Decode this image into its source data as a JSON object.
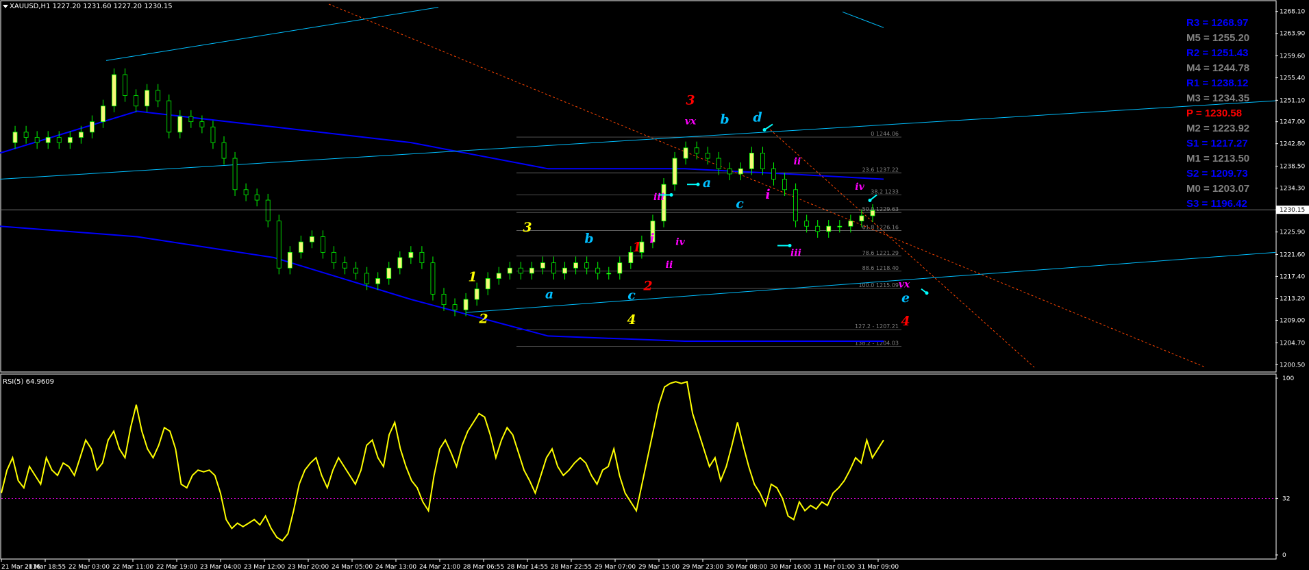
{
  "window": {
    "symbol_line": "XAUUSD,H1  1227.20 1231.60 1227.20 1230.15",
    "rsi_label": "RSI(5) 64.9609"
  },
  "colors": {
    "background": "#000000",
    "axis": "#ffffff",
    "bull_candle": "#f7f77a",
    "bear_candle": "#000000",
    "wick": "#00ff00",
    "rsi_line": "#ffff00",
    "ma_line": "#0000ff",
    "channel": "#00bfff",
    "dotted_channel": "#ff4500",
    "fib": "#808080"
  },
  "pivots": [
    {
      "label": "R3 = 1268.97",
      "color": "#0000ff",
      "price": 1268.97
    },
    {
      "label": "M5 = 1255.20",
      "color": "#808080",
      "price": 1255.2
    },
    {
      "label": "R2 = 1251.43",
      "color": "#0000ff",
      "price": 1251.43
    },
    {
      "label": "M4 = 1244.78",
      "color": "#808080",
      "price": 1244.78
    },
    {
      "label": "R1 = 1238.12",
      "color": "#0000ff",
      "price": 1238.12
    },
    {
      "label": "M3 = 1234.35",
      "color": "#808080",
      "price": 1234.35
    },
    {
      "label": "P  = 1230.58",
      "color": "#ff0000",
      "price": 1230.58
    },
    {
      "label": "M2 = 1223.92",
      "color": "#808080",
      "price": 1223.92
    },
    {
      "label": "S1 = 1217.27",
      "color": "#0000ff",
      "price": 1217.27
    },
    {
      "label": "M1 = 1213.50",
      "color": "#808080",
      "price": 1213.5
    },
    {
      "label": "S2 = 1209.73",
      "color": "#0000ff",
      "price": 1209.73
    },
    {
      "label": "M0 = 1203.07",
      "color": "#808080",
      "price": 1203.07
    },
    {
      "label": "S3 = 1196.42",
      "color": "#0000ff",
      "price": 1196.42
    }
  ],
  "chart_data": [
    {
      "type": "candlestick",
      "title": "XAUUSD,H1",
      "y_ticks": [
        "1268.10",
        "1263.90",
        "1259.60",
        "1255.40",
        "1251.10",
        "1247.00",
        "1242.80",
        "1238.50",
        "1234.30",
        "1230.15",
        "1225.90",
        "1221.60",
        "1217.40",
        "1213.20",
        "1209.00",
        "1204.70",
        "1200.50"
      ],
      "ylim": [
        1199.5,
        1269.5
      ],
      "current_price": 1230.15,
      "x_tick_labels": [
        "21 Mar 2016",
        "21 Mar 18:55",
        "22 Mar 03:00",
        "22 Mar 11:00",
        "22 Mar 19:00",
        "23 Mar 04:00",
        "23 Mar 12:00",
        "23 Mar 20:00",
        "24 Mar 05:00",
        "24 Mar 13:00",
        "24 Mar 21:00",
        "28 Mar 06:55",
        "28 Mar 14:55",
        "28 Mar 22:55",
        "29 Mar 07:00",
        "29 Mar 15:00",
        "29 Mar 23:00",
        "30 Mar 08:00",
        "30 Mar 16:00",
        "31 Mar 01:00",
        "31 Mar 09:00"
      ],
      "close_path": [
        1243,
        1245,
        1244,
        1243,
        1244,
        1243,
        1244,
        1245,
        1247,
        1250,
        1256,
        1252,
        1250,
        1253,
        1251,
        1245,
        1248,
        1247,
        1246,
        1243,
        1240,
        1234,
        1233,
        1232,
        1228,
        1219,
        1222,
        1224,
        1225,
        1222,
        1220,
        1219,
        1218,
        1216,
        1217,
        1219,
        1221,
        1222,
        1220,
        1214,
        1212,
        1211,
        1213,
        1215,
        1217,
        1218,
        1219,
        1218,
        1219,
        1220,
        1218,
        1219,
        1220,
        1219,
        1218,
        1218,
        1220,
        1222,
        1224,
        1228,
        1235,
        1240,
        1242,
        1241,
        1240,
        1238,
        1237,
        1238,
        1241,
        1238,
        1236,
        1234,
        1228,
        1227,
        1226,
        1227,
        1227,
        1228,
        1229,
        1230
      ],
      "fib_levels": [
        {
          "label": "0 1244.06",
          "price": 1244.06
        },
        {
          "label": "23.6 1237.22",
          "price": 1237.22
        },
        {
          "label": "38.2 1233",
          "price": 1233.0
        },
        {
          "label": "50.0 1229.63",
          "price": 1229.63
        },
        {
          "label": "61.8 1226.16",
          "price": 1226.16
        },
        {
          "label": "78.6 1221.29",
          "price": 1221.29
        },
        {
          "label": "88.6 1218.40",
          "price": 1218.4
        },
        {
          "label": "100.0 1215.09",
          "price": 1215.09
        },
        {
          "label": "127.2 - 1207.21",
          "price": 1207.21
        },
        {
          "label": "138.2 - 1204.03",
          "price": 1204.03
        }
      ],
      "wave_labels": [
        {
          "text": "1",
          "color": "#ffff00",
          "price": 1216.5
        },
        {
          "text": "2",
          "color": "#ffff00",
          "price": 1208.5
        },
        {
          "text": "3",
          "color": "#ffff00",
          "price": 1226.0
        },
        {
          "text": "4",
          "color": "#ffff00",
          "price": 1208.3
        },
        {
          "text": "a",
          "color": "#00bfff",
          "price": 1213.2
        },
        {
          "text": "b",
          "color": "#00bfff",
          "price": 1223.8
        },
        {
          "text": "c",
          "color": "#00bfff",
          "price": 1213.0
        },
        {
          "text": "1",
          "color": "#ff0000",
          "price": 1222.2
        },
        {
          "text": "2",
          "color": "#ff0000",
          "price": 1214.8
        },
        {
          "text": "3",
          "color": "#ff0000",
          "price": 1250.3
        },
        {
          "text": "4",
          "color": "#ff0000",
          "price": 1208.0
        },
        {
          "text": "i",
          "color": "#ff00ff",
          "price": 1223.8
        },
        {
          "text": "ii",
          "color": "#ff00ff",
          "price": 1219.0
        },
        {
          "text": "iii",
          "color": "#ff00ff",
          "price": 1232.0
        },
        {
          "text": "iv",
          "color": "#ff00ff",
          "price": 1223.4
        },
        {
          "text": "vx",
          "color": "#ff00ff",
          "price": 1246.5
        },
        {
          "text": "a",
          "color": "#00bfff",
          "price": 1234.5
        },
        {
          "text": "b",
          "color": "#00bfff",
          "price": 1246.6
        },
        {
          "text": "c",
          "color": "#00bfff",
          "price": 1230.5
        },
        {
          "text": "d",
          "color": "#00bfff",
          "price": 1247.0
        },
        {
          "text": "i",
          "color": "#ff00ff",
          "price": 1232.3
        },
        {
          "text": "ii",
          "color": "#ff00ff",
          "price": 1238.8
        },
        {
          "text": "iii",
          "color": "#ff00ff",
          "price": 1221.3
        },
        {
          "text": "iv",
          "color": "#ff00ff",
          "price": 1234.0
        },
        {
          "text": "vx",
          "color": "#ff00ff",
          "price": 1215.3
        },
        {
          "text": "e",
          "color": "#00bfff",
          "price": 1212.5
        }
      ]
    },
    {
      "type": "line",
      "title": "RSI(5) 64.9609",
      "y_ticks": [
        "100",
        "32",
        "0"
      ],
      "ylim": [
        0,
        100
      ],
      "reference_level": 32,
      "values": [
        35,
        48,
        55,
        42,
        38,
        50,
        45,
        40,
        55,
        48,
        45,
        52,
        50,
        45,
        55,
        65,
        60,
        48,
        52,
        65,
        70,
        60,
        55,
        72,
        85,
        70,
        60,
        55,
        62,
        72,
        70,
        60,
        40,
        38,
        45,
        48,
        47,
        48,
        45,
        35,
        20,
        15,
        18,
        16,
        18,
        20,
        17,
        22,
        15,
        10,
        8,
        12,
        25,
        40,
        48,
        52,
        55,
        45,
        38,
        48,
        55,
        50,
        45,
        40,
        48,
        62,
        65,
        55,
        50,
        68,
        75,
        60,
        50,
        42,
        38,
        30,
        25,
        45,
        60,
        65,
        58,
        50,
        62,
        70,
        75,
        80,
        78,
        68,
        55,
        65,
        72,
        68,
        58,
        48,
        42,
        35,
        45,
        55,
        60,
        50,
        45,
        48,
        52,
        55,
        52,
        45,
        40,
        48,
        50,
        60,
        45,
        35,
        30,
        25,
        40,
        55,
        70,
        85,
        95,
        97,
        98,
        97,
        98,
        80,
        70,
        60,
        50,
        55,
        42,
        50,
        62,
        75,
        62,
        50,
        40,
        35,
        28,
        40,
        38,
        32,
        22,
        20,
        30,
        25,
        28,
        26,
        30,
        28,
        35,
        38,
        42,
        48,
        55,
        52,
        65,
        55,
        60
      ],
      "values_tail": [
        65
      ]
    }
  ]
}
